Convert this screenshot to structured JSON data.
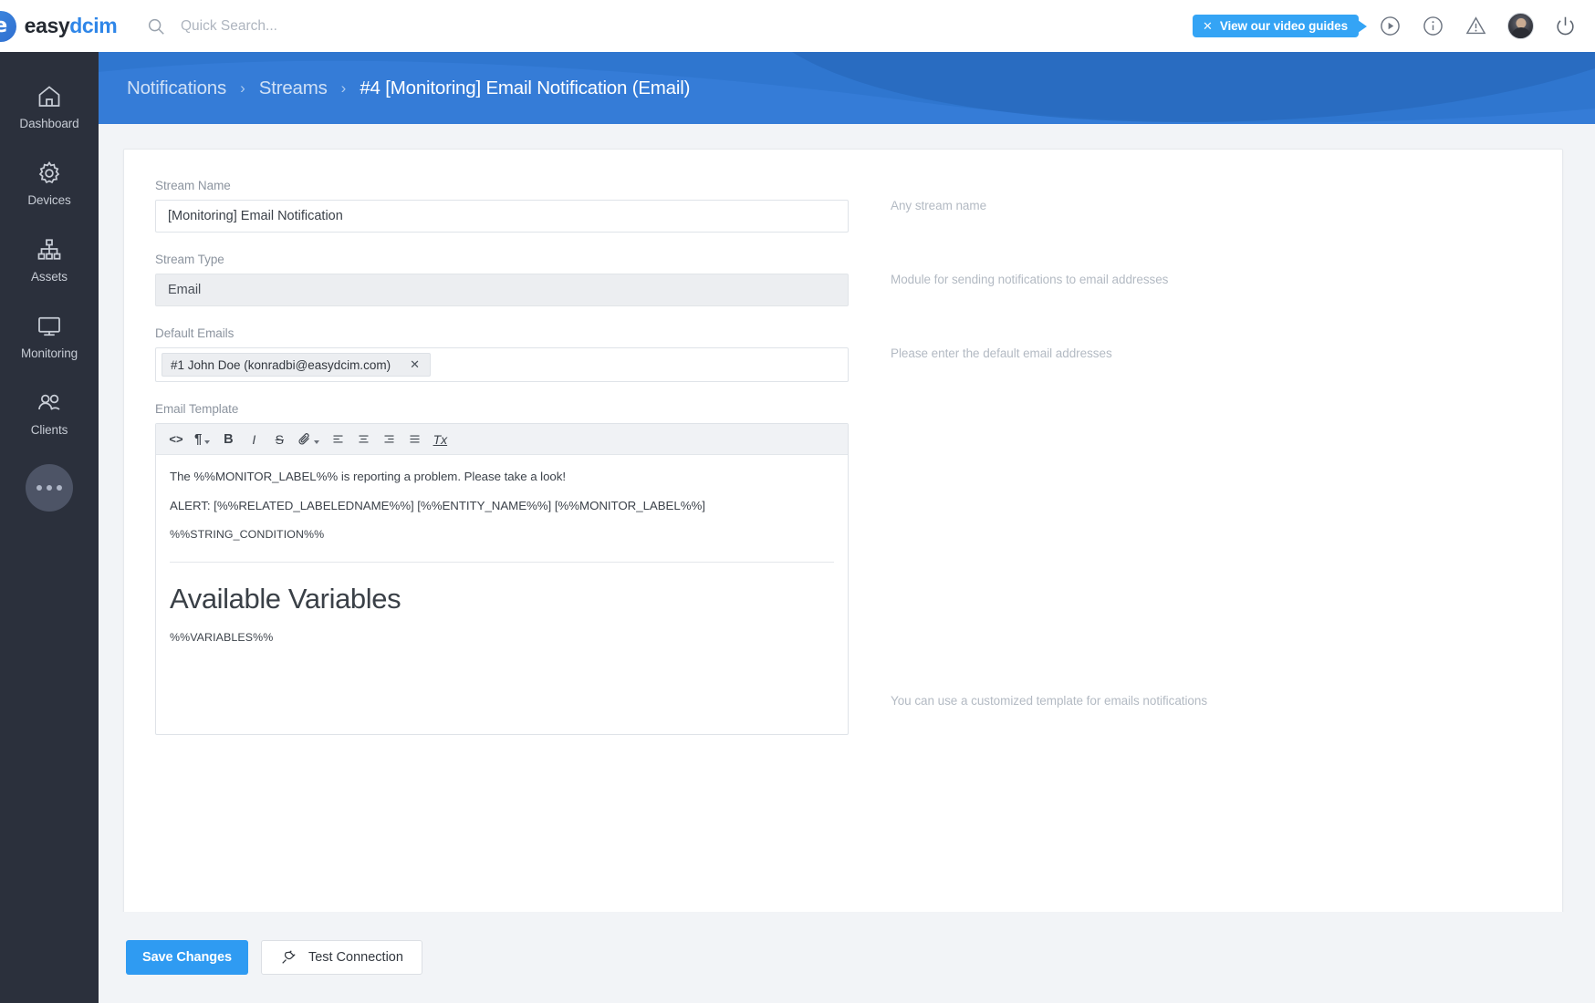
{
  "topbar": {
    "brand_a": "easy",
    "brand_b": "dcim",
    "logo_letter": "e",
    "search_placeholder": "Quick Search...",
    "search_value": "",
    "video_pill_close": "✕",
    "video_pill_label": "View our video guides"
  },
  "sidebar": {
    "items": [
      {
        "label": "Dashboard",
        "icon": "home-icon"
      },
      {
        "label": "Devices",
        "icon": "gear-icon"
      },
      {
        "label": "Assets",
        "icon": "sitemap-icon"
      },
      {
        "label": "Monitoring",
        "icon": "monitor-icon"
      },
      {
        "label": "Clients",
        "icon": "users-icon"
      }
    ],
    "more_label": "More"
  },
  "breadcrumb": {
    "items": [
      "Notifications",
      "Streams",
      "#4 [Monitoring] Email Notification (Email)"
    ],
    "separator": "›"
  },
  "form": {
    "stream_name": {
      "label": "Stream Name",
      "value": "[Monitoring] Email Notification",
      "hint": "Any stream name"
    },
    "stream_type": {
      "label": "Stream Type",
      "value": "Email",
      "hint": "Module for sending notifications to email addresses"
    },
    "default_emails": {
      "label": "Default Emails",
      "token": "#1 John Doe (konradbi@easydcim.com)",
      "token_remove": "✕",
      "hint": "Please enter the default email addresses"
    },
    "email_template": {
      "label": "Email Template",
      "hint": "You can use a customized template for emails notifications",
      "toolbar": [
        {
          "name": "code-icon",
          "glyph": "<>"
        },
        {
          "name": "paragraph-icon",
          "glyph": "¶"
        },
        {
          "name": "bold-icon",
          "glyph": "B"
        },
        {
          "name": "italic-icon",
          "glyph": "I"
        },
        {
          "name": "strikethrough-icon",
          "glyph": "S"
        },
        {
          "name": "link-icon",
          "glyph": "link"
        },
        {
          "name": "align-left-icon",
          "glyph": "align-left"
        },
        {
          "name": "align-center-icon",
          "glyph": "align-center"
        },
        {
          "name": "align-right-icon",
          "glyph": "align-right"
        },
        {
          "name": "align-justify-icon",
          "glyph": "align-justify"
        },
        {
          "name": "clear-format-icon",
          "glyph": "Tx"
        }
      ],
      "content": {
        "line1": "The %%MONITOR_LABEL%% is reporting a problem. Please take a look!",
        "line2": "ALERT: [%%RELATED_LABELEDNAME%%] [%%ENTITY_NAME%%] [%%MONITOR_LABEL%%]",
        "line3": "%%STRING_CONDITION%%",
        "heading": "Available Variables",
        "line4": "%%VARIABLES%%"
      }
    }
  },
  "footer": {
    "save_label": "Save Changes",
    "test_label": "Test Connection"
  },
  "colors": {
    "brand_blue": "#2f86e8",
    "banner_blue": "#2f76cf",
    "accent": "#34a4f5",
    "sidebar_dark": "#2b303c",
    "page_bg": "#f2f4f7"
  }
}
